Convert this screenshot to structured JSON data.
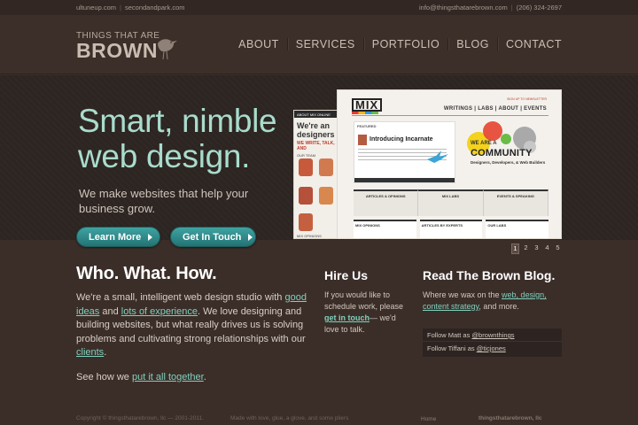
{
  "topbar": {
    "site1": "ultuneup.com",
    "site2": "secondandpark.com",
    "email": "info@thingsthatarebrown.com",
    "phone": "(206) 324-2697"
  },
  "logo": {
    "small": "THINGS THAT ARE",
    "big": "BROWN"
  },
  "nav": {
    "items": [
      "ABOUT",
      "SERVICES",
      "PORTFOLIO",
      "BLOG",
      "CONTACT"
    ]
  },
  "hero": {
    "title_line1": "Smart, nimble",
    "title_line2": "web design.",
    "subtitle": "We make websites that help your business grow.",
    "btn_more": "Learn More",
    "btn_touch": "Get In Touch"
  },
  "showcase": {
    "back_title": "ABOUT MIX ONLINE",
    "back_big": "We're an designers",
    "back_red": "WE WRITE, TALK, AND",
    "back_team": "OUR TEAM",
    "back_opinion": "MIX OPINIONS",
    "mix_logo": "MIX",
    "mix_nav": "WRITINGS | LABS | ABOUT | EVENTS",
    "mix_sign": "SIGN UP TO NEWSLETTER",
    "featured_label": "FEATURED",
    "featured_title": "Introducing Incarnate",
    "we_are_a": "WE ARE A",
    "community": "COMMUNITY",
    "community_for": "Designers, Developers, & Web Builders",
    "col_a": "ARTICLES & OPINIONS",
    "col_b": "MIX LABS",
    "col_c": "EVENTS & SPEAKING",
    "col2_a": "MIX OPINIONS",
    "col2_b": "ARTICLES BY EXPERTS",
    "col2_c": "OUR LABS",
    "pages": [
      "1",
      "2",
      "3",
      "4",
      "5"
    ],
    "active_page": "1"
  },
  "who": {
    "heading": "Who. What. How.",
    "t1": "We're a small, intelligent web design studio with ",
    "l1": "good ideas",
    "t2": " and ",
    "l2": "lots of experience",
    "t3": ". We love designing and building websites, but what really drives us is solving problems and cultivating strong relationships with our ",
    "l3": "clients",
    "t4": ".",
    "see_t": "See how we ",
    "see_l": "put it all together",
    "see_end": "."
  },
  "hire": {
    "heading": "Hire Us",
    "t1": "If you would like to schedule work, please ",
    "l1": "get in touch",
    "t2": "— we'd love to talk."
  },
  "blog": {
    "heading": "Read The Brown Blog.",
    "t1": "Where we wax on the ",
    "l1": "web, design, content strategy",
    "t2": ", and more.",
    "follow1_t": "Follow Matt as ",
    "follow1_l": "@brownthings",
    "follow2_t": "Follow Tiffani as ",
    "follow2_l": "@ticjones"
  },
  "footer": {
    "copyright": "Copyright © thingsthatarebrown, llc — 2001-2011.",
    "made": "Made with love, glue, a glove, and some pliers",
    "home": "Home",
    "tag": "thingsthatarebrown, llc"
  },
  "colors": {
    "accent": "#7fd0bd",
    "hero_title": "#a9dccd",
    "button": "#2f8a8a",
    "background": "#3b2e29"
  }
}
